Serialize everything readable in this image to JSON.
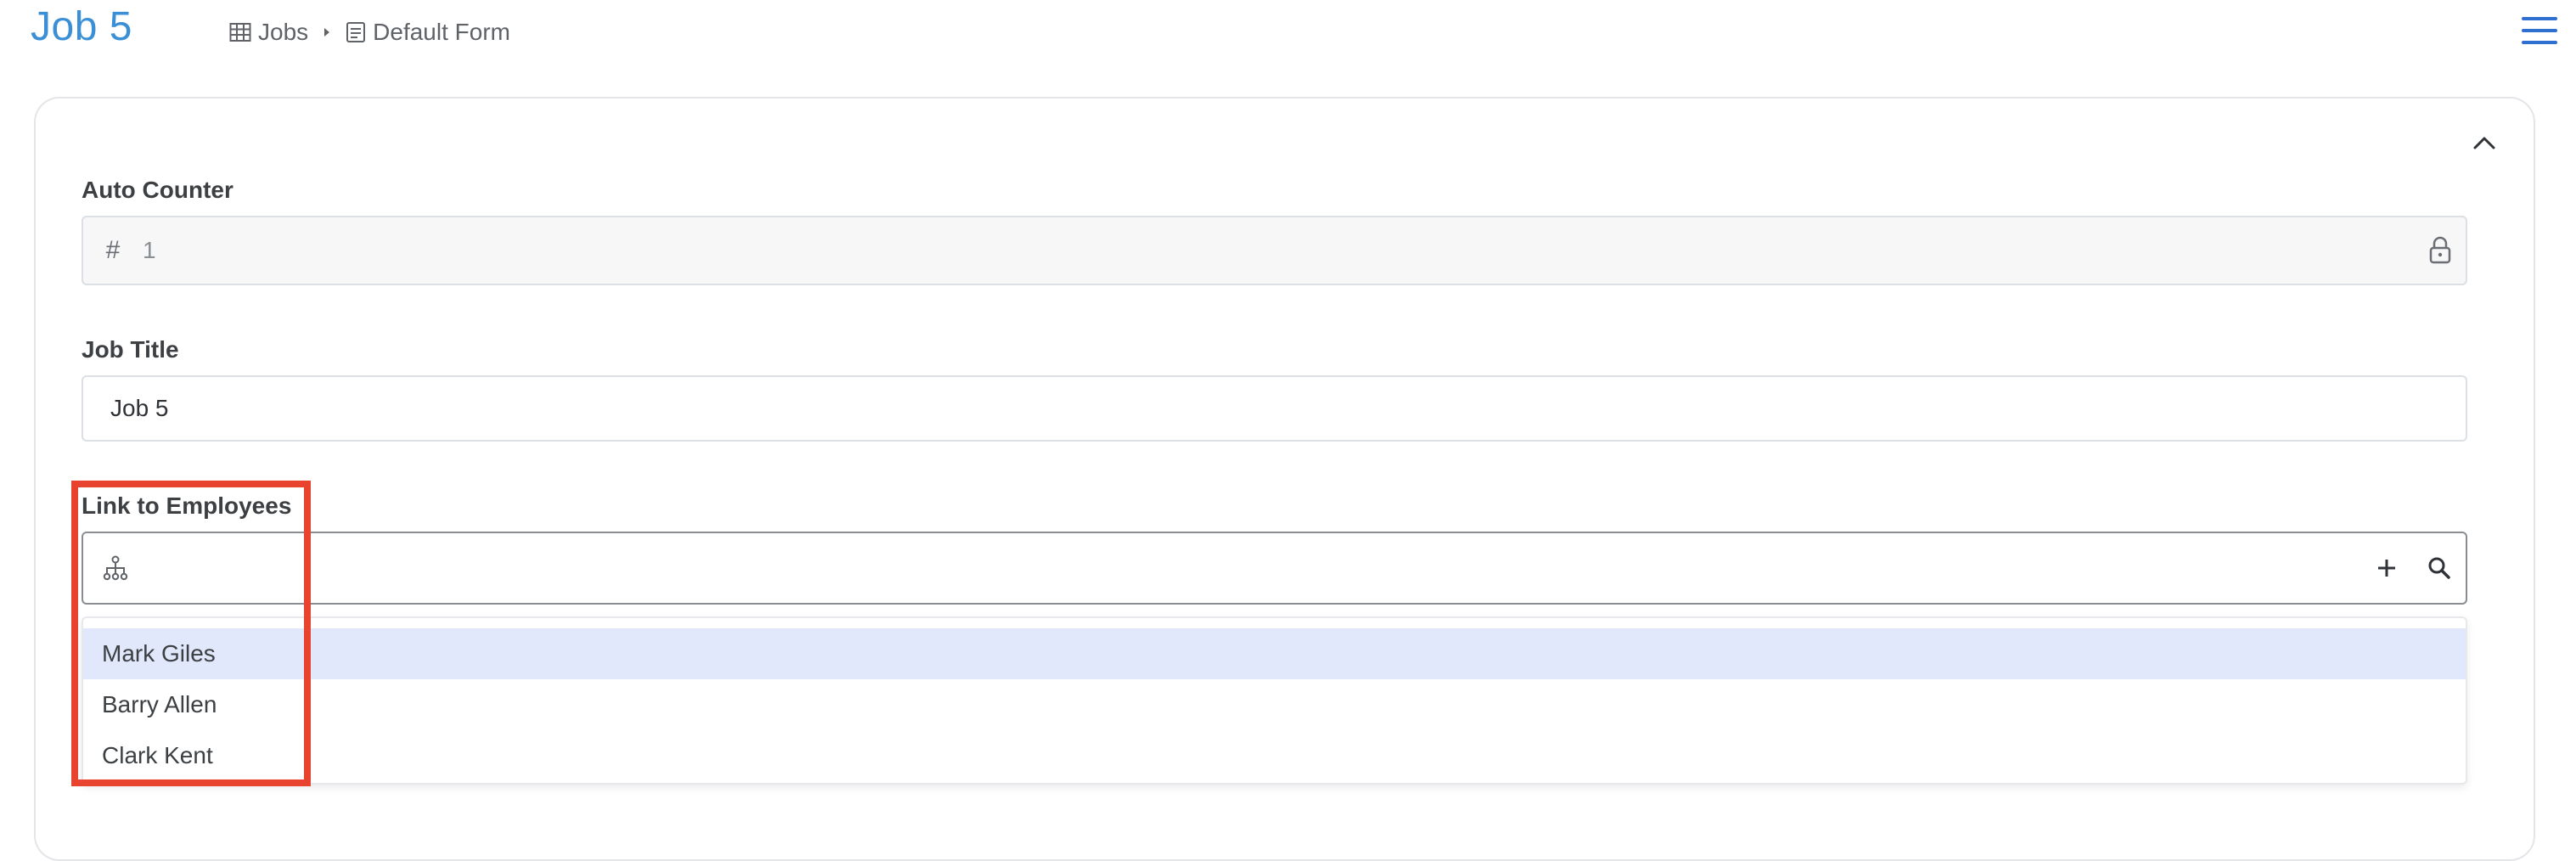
{
  "page": {
    "title": "Job 5"
  },
  "breadcrumb": {
    "items": [
      {
        "label": "Jobs",
        "icon": "table-icon"
      },
      {
        "label": "Default Form",
        "icon": "form-icon"
      }
    ]
  },
  "form": {
    "auto_counter": {
      "label": "Auto Counter",
      "value": "1",
      "prefix_symbol": "#"
    },
    "job_title": {
      "label": "Job Title",
      "value": "Job 5"
    },
    "link_to_employees": {
      "label": "Link to Employees",
      "search_value": "",
      "options": [
        "Mark Giles",
        "Barry Allen",
        "Clark Kent"
      ],
      "highlighted_option": "Mark Giles"
    }
  },
  "colors": {
    "accent": "#3a8fd6",
    "highlight_box": "#e8432f",
    "option_hover": "#e1e8fb",
    "menu_icon": "#2f6fd0"
  }
}
